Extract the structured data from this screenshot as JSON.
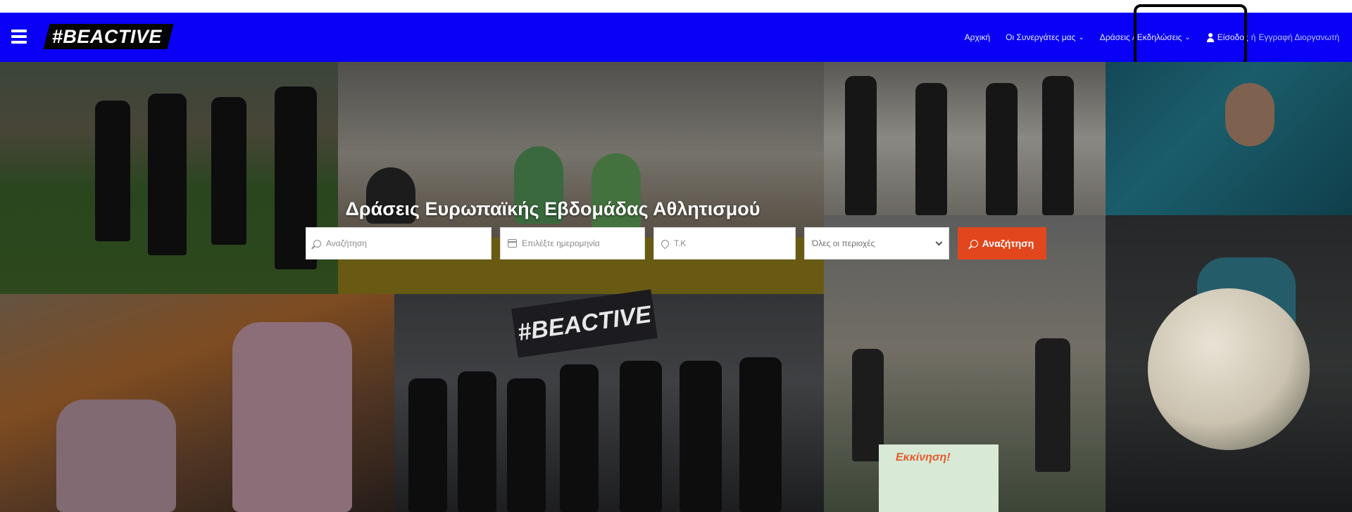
{
  "nav": {
    "logo": "#BEACTIVE",
    "links": [
      {
        "label": "Αρχική"
      },
      {
        "label": "Οι Συνεργάτες μας",
        "caret": true
      },
      {
        "label": "Δράσεις / Εκδηλώσεις",
        "caret": true
      }
    ],
    "login": "Είσοδος",
    "or": "ή",
    "register": "Εγγραφή Διοργανωτή"
  },
  "hero": {
    "title": "Δράσεις Ευρωπαϊκής Εβδομάδας Αθλητισμού",
    "banner_text": "Εκκίνηση!"
  },
  "search": {
    "keyword_placeholder": "Αναζήτηση",
    "date_placeholder": "Επιλέξτε ημερομηνία",
    "zip_placeholder": "Τ.Κ",
    "region_selected": "Όλες οι περιοχές",
    "button_label": "Αναζήτηση"
  },
  "colors": {
    "nav_background": "#0a00f5",
    "search_button": "#e2461d"
  }
}
